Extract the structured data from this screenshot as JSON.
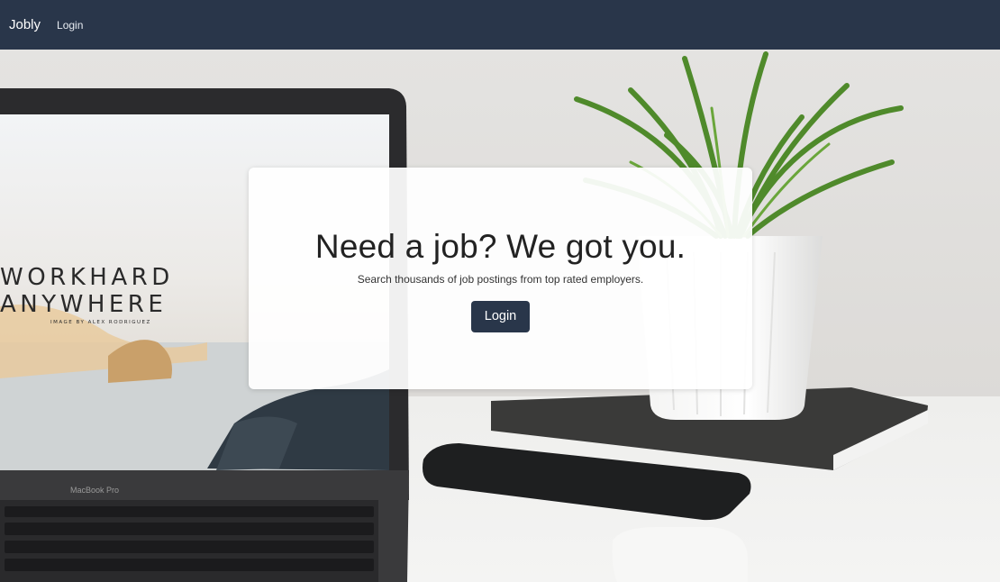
{
  "navbar": {
    "brand": "Jobly",
    "login_link": "Login"
  },
  "hero": {
    "title": "Need a job? We got you.",
    "subtitle": "Search thousands of job postings from top rated employers.",
    "login_button": "Login"
  },
  "background_photo": {
    "screen_line_1": "WORKHARD",
    "screen_line_2": "ANYWHERE",
    "screen_credit": "IMAGE BY ALEX RODRIGUEZ",
    "laptop_label": "MacBook Pro"
  },
  "colors": {
    "navbar_bg": "#29364a",
    "button_bg": "#29364a",
    "card_bg": "#ffffff"
  }
}
